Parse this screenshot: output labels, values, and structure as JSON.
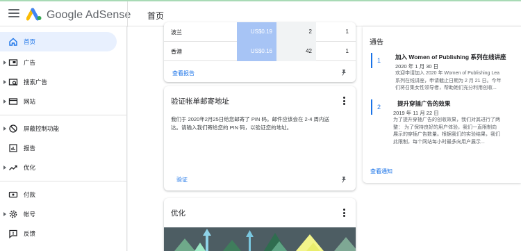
{
  "header": {
    "brand": "Google AdSense",
    "page_title": "首页"
  },
  "sidebar": {
    "items": [
      {
        "label": "首页",
        "icon": "home-icon",
        "active": true
      },
      {
        "label": "广告",
        "icon": "ads-icon"
      },
      {
        "label": "搜索广告",
        "icon": "search-ads-icon"
      },
      {
        "label": "网站",
        "icon": "sites-icon"
      },
      {
        "label": "屏蔽控制功能",
        "icon": "block-icon"
      },
      {
        "label": "报告",
        "icon": "report-icon"
      },
      {
        "label": "优化",
        "icon": "optimize-icon"
      },
      {
        "label": "付款",
        "icon": "payments-icon"
      },
      {
        "label": "帐号",
        "icon": "gear-icon"
      },
      {
        "label": "反馈",
        "icon": "feedback-icon"
      }
    ]
  },
  "report_card": {
    "rows": [
      {
        "country": "波兰",
        "revenue": "US$0.19",
        "c2": "2",
        "c3": "1"
      },
      {
        "country": "香港",
        "revenue": "US$0.16",
        "c2": "42",
        "c3": "1"
      }
    ],
    "link": "查看报告"
  },
  "verify_card": {
    "title": "验证帐单邮寄地址",
    "body_line1": "我们于 2020年2月25日给您邮寄了 PIN 码。邮件应该会在 2-4 周内送",
    "body_line2": "达。请输入我们寄给您的 PIN 码，以验证您的地址。",
    "action": "验证"
  },
  "optimize_card": {
    "title": "优化"
  },
  "notices": {
    "heading": "通告",
    "items": [
      {
        "num": "1",
        "title": "加入 Women of Publishing 系列在线讲座",
        "date": "2020 年 1 月 30 日",
        "lines": [
          "欢迎申请加入 2020 年 Women of Publishing Lea",
          "系列在线讲座，申请截止日期为 2 月 21 日。今年",
          "们将召集女性领导者，帮助她们充分利用创收..."
        ]
      },
      {
        "num": "2",
        "title": "提升穿插广告的效果",
        "date": "2019 年 11 月 22 日",
        "lines": [
          "为了提升穿插广告的创收效果，我们对其进行了两",
          "整：  为了保持良好的用户体验，我们一直限制向",
          "展示的穿插广告数量。根据我们的实验结果，我们",
          "此限制，每个网站每小时最多向用户展示..."
        ]
      }
    ],
    "link": "查看通知"
  },
  "colors": {
    "accent": "#1a73e8",
    "active_bg": "#e8f0fe",
    "revenue_bar": "#a7c4f5"
  }
}
